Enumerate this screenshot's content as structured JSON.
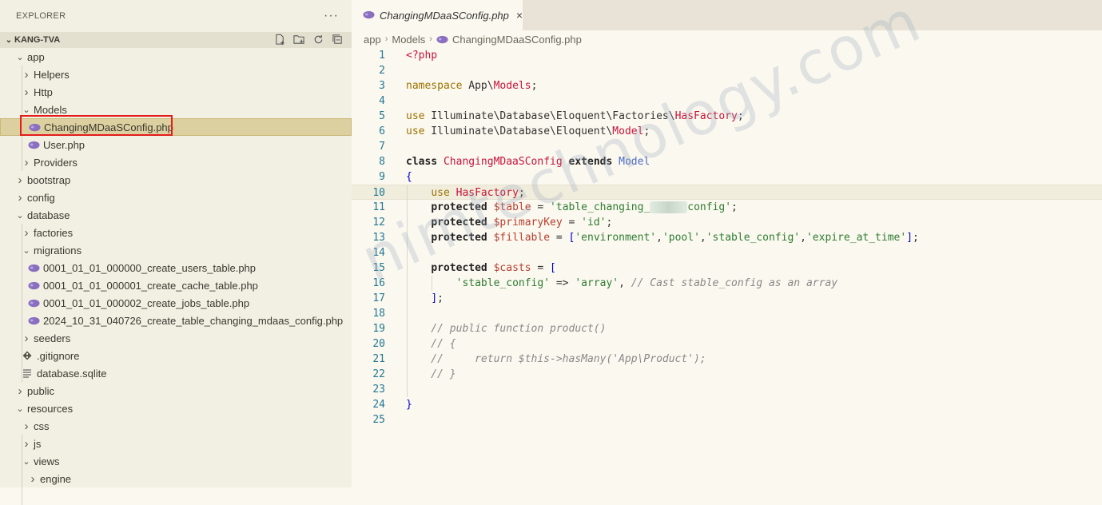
{
  "explorer": {
    "title": "EXPLORER",
    "more": "···",
    "workspace": "KANG-TVA",
    "tree": [
      {
        "label": "app",
        "depth": 0,
        "type": "folder-open"
      },
      {
        "label": "Helpers",
        "depth": 1,
        "type": "folder"
      },
      {
        "label": "Http",
        "depth": 1,
        "type": "folder"
      },
      {
        "label": "Models",
        "depth": 1,
        "type": "folder-open"
      },
      {
        "label": "ChangingMDaaSConfig.php",
        "depth": 2,
        "type": "php",
        "selected": true
      },
      {
        "label": "User.php",
        "depth": 2,
        "type": "php"
      },
      {
        "label": "Providers",
        "depth": 1,
        "type": "folder"
      },
      {
        "label": "bootstrap",
        "depth": 0,
        "type": "folder"
      },
      {
        "label": "config",
        "depth": 0,
        "type": "folder"
      },
      {
        "label": "database",
        "depth": 0,
        "type": "folder-open"
      },
      {
        "label": "factories",
        "depth": 1,
        "type": "folder"
      },
      {
        "label": "migrations",
        "depth": 1,
        "type": "folder-open"
      },
      {
        "label": "0001_01_01_000000_create_users_table.php",
        "depth": 2,
        "type": "php"
      },
      {
        "label": "0001_01_01_000001_create_cache_table.php",
        "depth": 2,
        "type": "php"
      },
      {
        "label": "0001_01_01_000002_create_jobs_table.php",
        "depth": 2,
        "type": "php"
      },
      {
        "label": "2024_10_31_040726_create_table_changing_mdaas_config.php",
        "depth": 2,
        "type": "php"
      },
      {
        "label": "seeders",
        "depth": 1,
        "type": "folder"
      },
      {
        "label": ".gitignore",
        "depth": 1,
        "type": "git"
      },
      {
        "label": "database.sqlite",
        "depth": 1,
        "type": "file"
      },
      {
        "label": "public",
        "depth": 0,
        "type": "folder"
      },
      {
        "label": "resources",
        "depth": 0,
        "type": "folder-open"
      },
      {
        "label": "css",
        "depth": 1,
        "type": "folder"
      },
      {
        "label": "js",
        "depth": 1,
        "type": "folder"
      },
      {
        "label": "views",
        "depth": 1,
        "type": "folder-open"
      },
      {
        "label": "engine",
        "depth": 2,
        "type": "folder"
      }
    ]
  },
  "tab": {
    "label": "ChangingMDaaSConfig.php",
    "close": "×"
  },
  "breadcrumb": [
    "app",
    "Models",
    "ChangingMDaaSConfig.php"
  ],
  "editor": {
    "current_line": 10,
    "lines": [
      "<?php",
      "",
      "namespace App\\Models;",
      "",
      "use Illuminate\\Database\\Eloquent\\Factories\\HasFactory;",
      "use Illuminate\\Database\\Eloquent\\Model;",
      "",
      "class ChangingMDaaSConfig extends Model",
      "{",
      "    use HasFactory;",
      "    protected $table = 'table_changing_mdaas_config';",
      "    protected $primaryKey = 'id';",
      "    protected $fillable = ['environment','pool','stable_config','expire_at_time'];",
      "",
      "    protected $casts = [",
      "        'stable_config' => 'array', // Cast stable_config as an array",
      "    ];",
      "",
      "    // public function product()",
      "    // {",
      "    //     return $this->hasMany('App\\Product');",
      "    // }",
      "",
      "}",
      ""
    ]
  },
  "watermark": "nimtechnology.com"
}
